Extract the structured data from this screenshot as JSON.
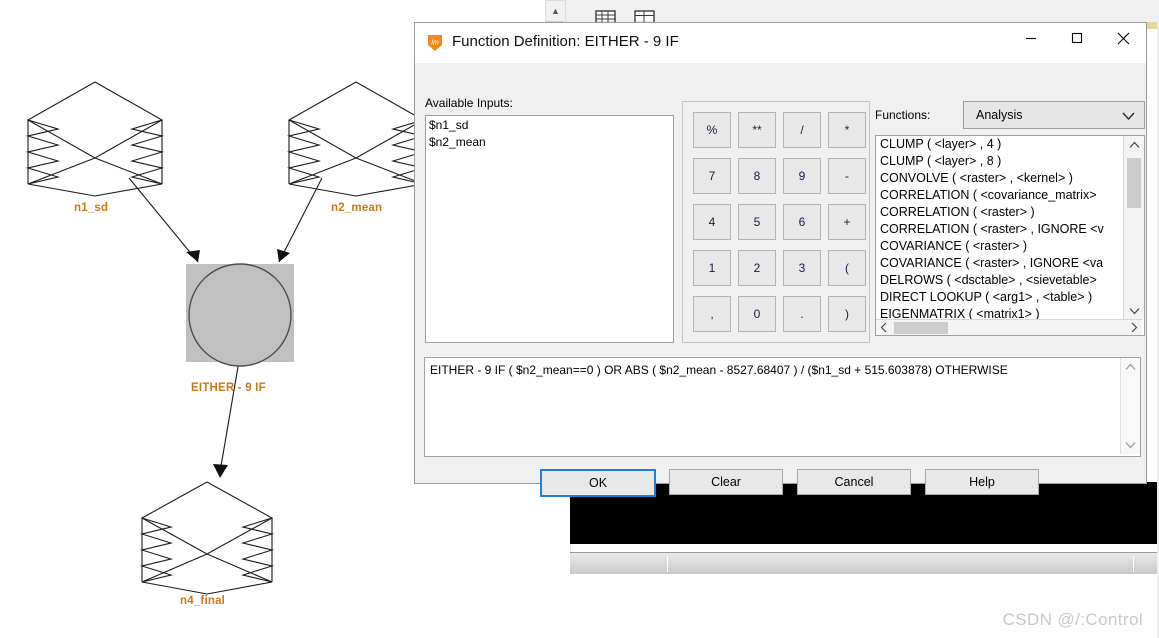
{
  "dialog": {
    "title": "Function Definition:  EITHER  - 9 IF",
    "app_icon": "imagine-app-icon",
    "window_buttons": {
      "minimize": "minimize-icon",
      "maximize": "maximize-icon",
      "close": "close-icon"
    },
    "available_inputs_label": "Available Inputs:",
    "available_inputs": [
      "$n1_sd",
      "$n2_mean"
    ],
    "keypad": [
      "%",
      "**",
      "/",
      "*",
      "7",
      "8",
      "9",
      "-",
      "4",
      "5",
      "6",
      "+",
      "1",
      "2",
      "3",
      "(",
      ",",
      "0",
      ".",
      ")"
    ],
    "functions_label": "Functions:",
    "functions_category": "Analysis",
    "functions_list": [
      "CLUMP ( <layer> , 4 )",
      "CLUMP ( <layer> , 8 )",
      "CONVOLVE ( <raster> , <kernel> )",
      "CORRELATION ( <covariance_matrix>",
      "CORRELATION ( <raster> )",
      "CORRELATION ( <raster> , IGNORE <v",
      "COVARIANCE ( <raster> )",
      "COVARIANCE ( <raster> , IGNORE <va",
      "DELROWS ( <dsctable> , <sievetable>",
      "DIRECT LOOKUP ( <arg1> , <table> )",
      "EIGENMATRIX ( <matrix1> )"
    ],
    "formula": "EITHER  - 9 IF ( $n2_mean==0 ) OR ABS ( $n2_mean - 8527.68407 )  / ($n1_sd + 515.603878) OTHERWISE",
    "buttons": {
      "ok": "OK",
      "clear": "Clear",
      "cancel": "Cancel",
      "help": "Help"
    },
    "accent_color": "#1d7fd6"
  },
  "diagram": {
    "nodes": [
      {
        "name": "n1_sd",
        "label": "n1_sd",
        "type": "raster-stack"
      },
      {
        "name": "n2_mean",
        "label": "n2_mean",
        "type": "raster-stack"
      },
      {
        "name": "either-9-if",
        "label": "EITHER  - 9 IF",
        "type": "function-circle",
        "selected": true
      },
      {
        "name": "n4_final",
        "label": "n4_final",
        "type": "raster-stack"
      }
    ],
    "label_color": "#c97a16"
  },
  "watermark": "CSDN @/:Control"
}
